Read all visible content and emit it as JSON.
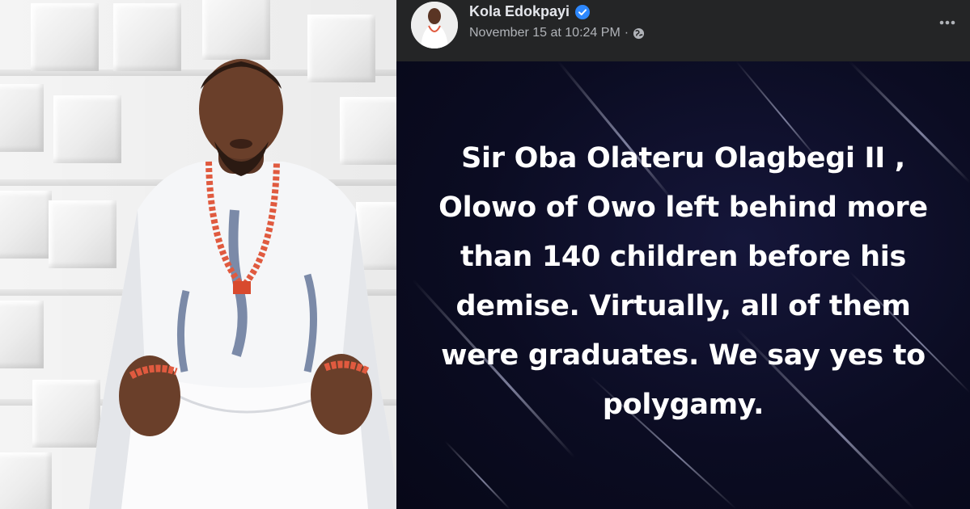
{
  "post": {
    "author": "Kola Edokpayi",
    "timestamp": "November 15 at 10:24 PM",
    "separator": "·",
    "text": "Sir Oba Olateru Olagbegi II , Olowo of Owo left behind more than 140 children before his demise. Virtually, all of them were graduates. We say yes to polygamy."
  },
  "icons": {
    "verified": "verified-badge-icon",
    "audience": "globe-icon",
    "more": "more-horizontal-icon"
  },
  "colors": {
    "header_bg": "#242526",
    "author_text": "#e4e6eb",
    "meta_text": "#b0b3b8",
    "verified_blue": "#2d88ff",
    "post_bg": "#0c0d1f",
    "post_text": "#ffffff"
  }
}
